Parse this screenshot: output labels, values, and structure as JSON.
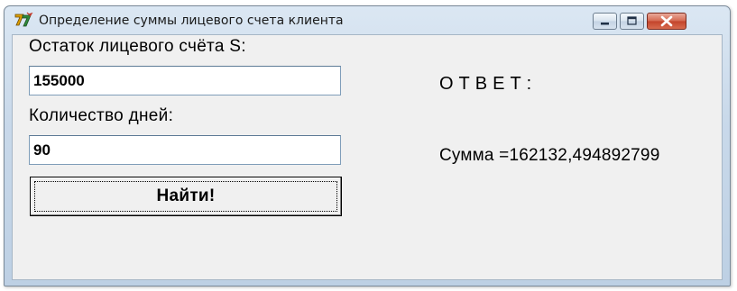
{
  "window": {
    "title": "Определение суммы лицевого счета клиента",
    "controls": {
      "minimize_icon": "minimize-icon",
      "maximize_icon": "maximize-icon",
      "close_icon": "close-icon"
    },
    "colors": {
      "close_button": "#c8442b",
      "client_area": "#f0f0f0"
    }
  },
  "form": {
    "balance_label": "Остаток лицевого счёта S:",
    "balance_value": "155000",
    "days_label": "Количество дней:",
    "days_value": "90",
    "find_button_label": "Найти!"
  },
  "answer": {
    "heading": "ОТВЕТ:",
    "sum_text": "Сумма =162132,494892799"
  }
}
